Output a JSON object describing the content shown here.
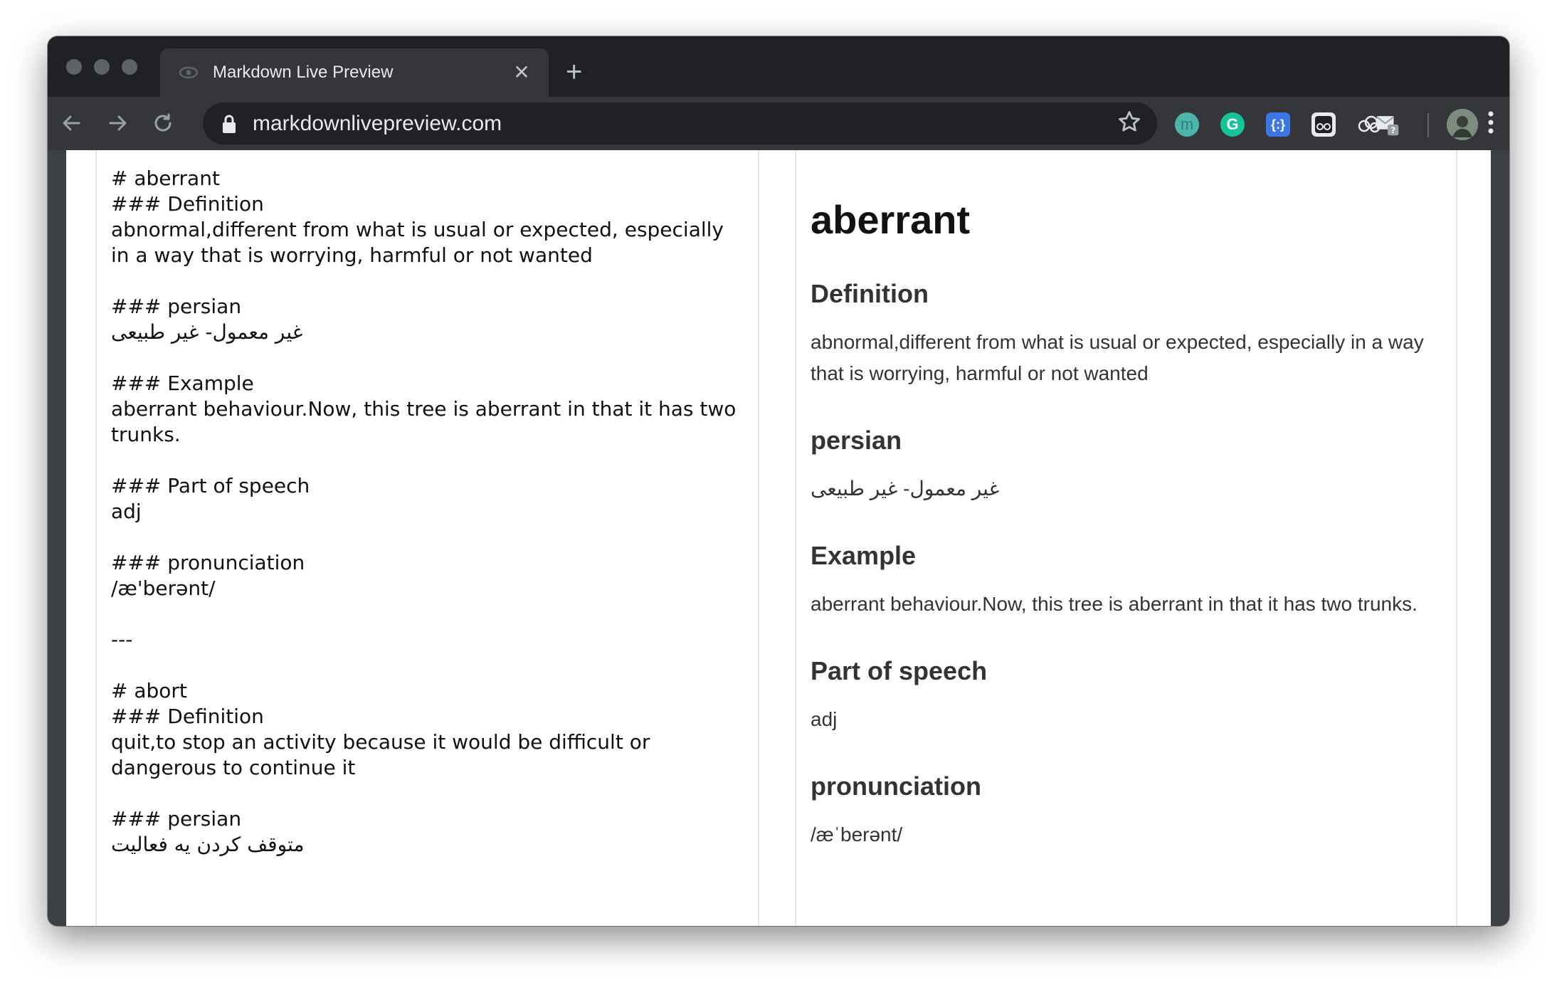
{
  "browser": {
    "tab_title": "Markdown Live Preview",
    "tab_close_glyph": "✕",
    "new_tab_glyph": "+",
    "url": "markdownlivepreview.com",
    "icons": {
      "back": "back-arrow-icon",
      "forward": "forward-arrow-icon",
      "reload": "reload-icon",
      "lock": "lock-icon",
      "bookmark": "star-icon",
      "menu": "kebab-menu-icon"
    },
    "extensions": [
      {
        "name": "mercury-extension-icon",
        "color": "#4db6ac",
        "glyph": "m"
      },
      {
        "name": "grammarly-extension-icon",
        "color": "#15c39a",
        "glyph": "G"
      },
      {
        "name": "json-viewer-extension-icon",
        "color": "#3b78e7",
        "glyph": "{:}"
      },
      {
        "name": "glasses-extension-icon",
        "color": "#e8eaed",
        "glyph": ""
      },
      {
        "name": "cloud-extension-icon",
        "color": "#e8eaed",
        "glyph": ""
      },
      {
        "name": "gmail-checker-extension-icon",
        "color": "#e8eaed",
        "glyph": "?"
      }
    ]
  },
  "editor": {
    "text": "# aberrant\n### Definition\nabnormal,different from what is usual or expected, especially in a way that is worrying, harmful or not wanted\n\n### persian\nغیر معمول- غیر طبیعی\n\n### Example\naberrant behaviour.Now, this tree is aberrant in that it has two trunks.\n\n### Part of speech\nadj\n\n### pronunciation\n/æ'berənt/\n\n---\n\n# abort\n### Definition\nquit,to stop an activity because it would be difficult or dangerous to continue it\n\n### persian\nمتوقف کردن یه فعالیت\n\n\n\n### Example"
  },
  "preview": {
    "title": "aberrant",
    "sections": [
      {
        "heading": "Definition",
        "body": "abnormal,different from what is usual or expected, especially in a way that is worrying, harmful or not wanted"
      },
      {
        "heading": "persian",
        "body": "غیر معمول- غیر طبیعی"
      },
      {
        "heading": "Example",
        "body": "aberrant behaviour.Now, this tree is aberrant in that it has two trunks."
      },
      {
        "heading": "Part of speech",
        "body": "adj"
      },
      {
        "heading": "pronunciation",
        "body": "/æˈberənt/"
      }
    ]
  }
}
